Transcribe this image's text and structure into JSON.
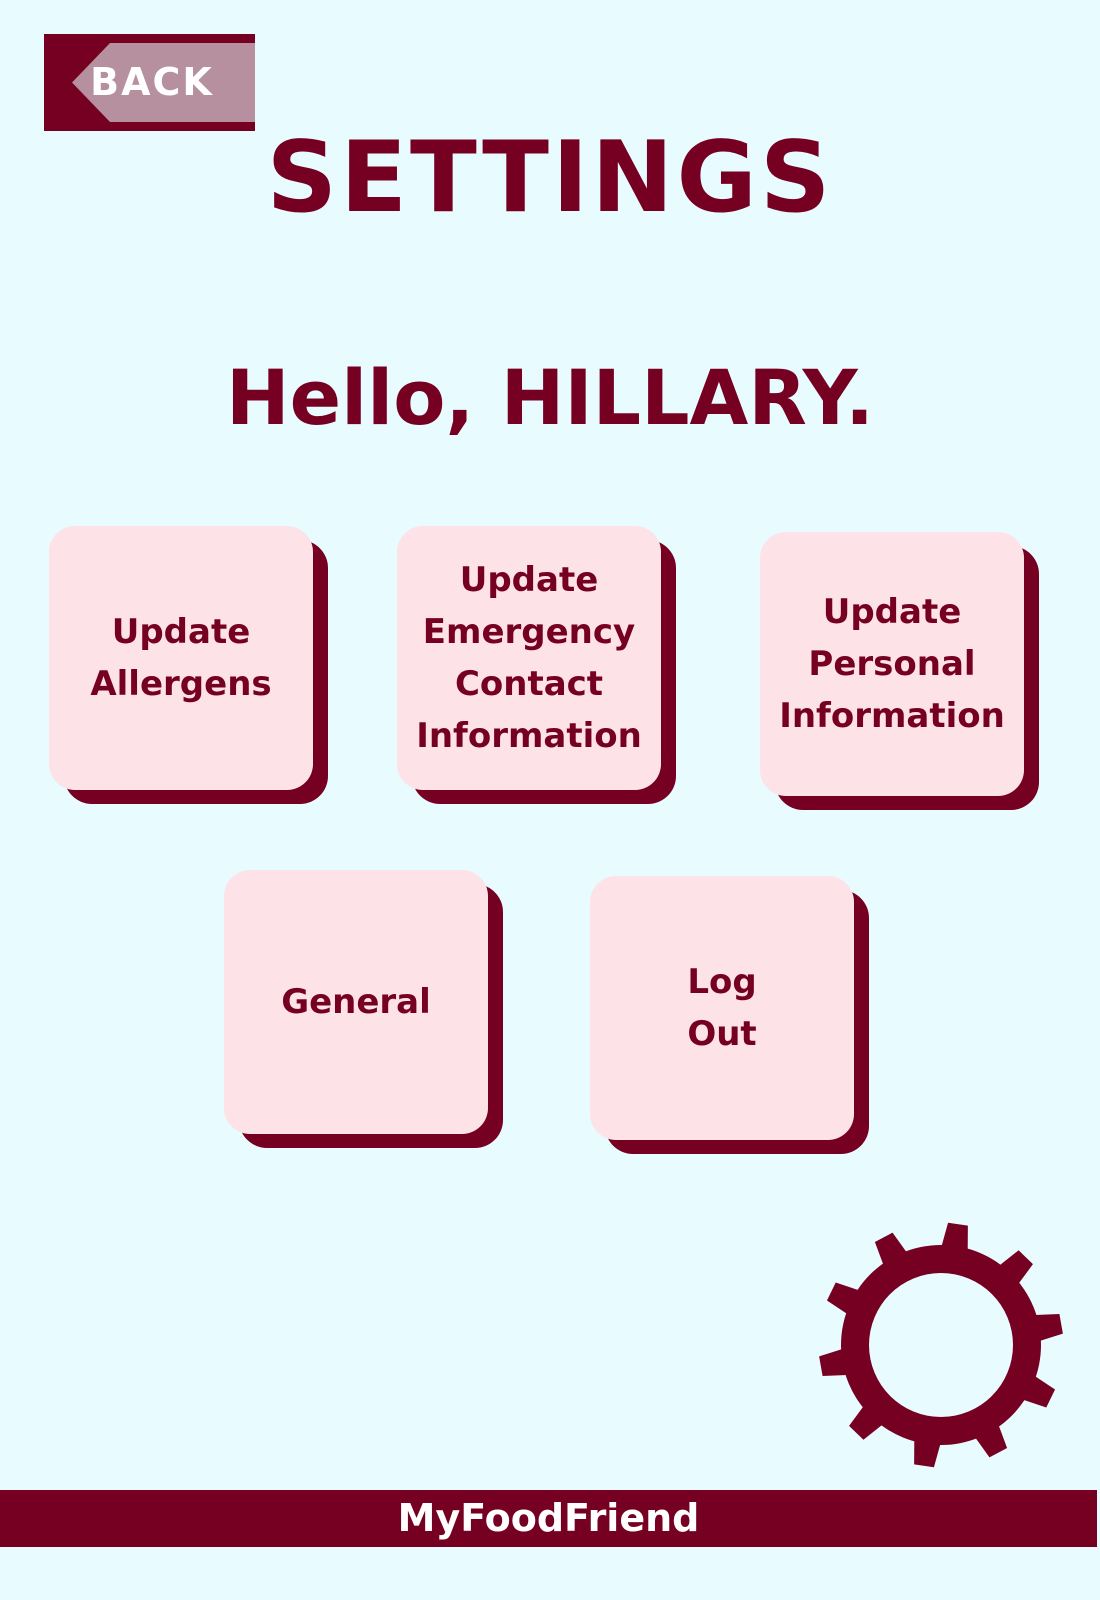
{
  "header": {
    "back_label": "BACK",
    "title": "SETTINGS"
  },
  "greeting": "Hello, HILLARY.",
  "tiles": [
    {
      "label": "Update\nAllergens"
    },
    {
      "label": "Update\nEmergency\nContact\nInformation"
    },
    {
      "label": "Update\nPersonal\nInformation"
    },
    {
      "label": "General"
    },
    {
      "label": "Log\nOut"
    }
  ],
  "icons": {
    "back": "left-arrow-icon",
    "settings": "gear-icon"
  },
  "footer": {
    "brand": "MyFoodFriend"
  },
  "colors": {
    "background": "#e8fbfe",
    "accent": "#760021",
    "tile": "#fde2e8",
    "back_highlight": "#b6909f"
  }
}
